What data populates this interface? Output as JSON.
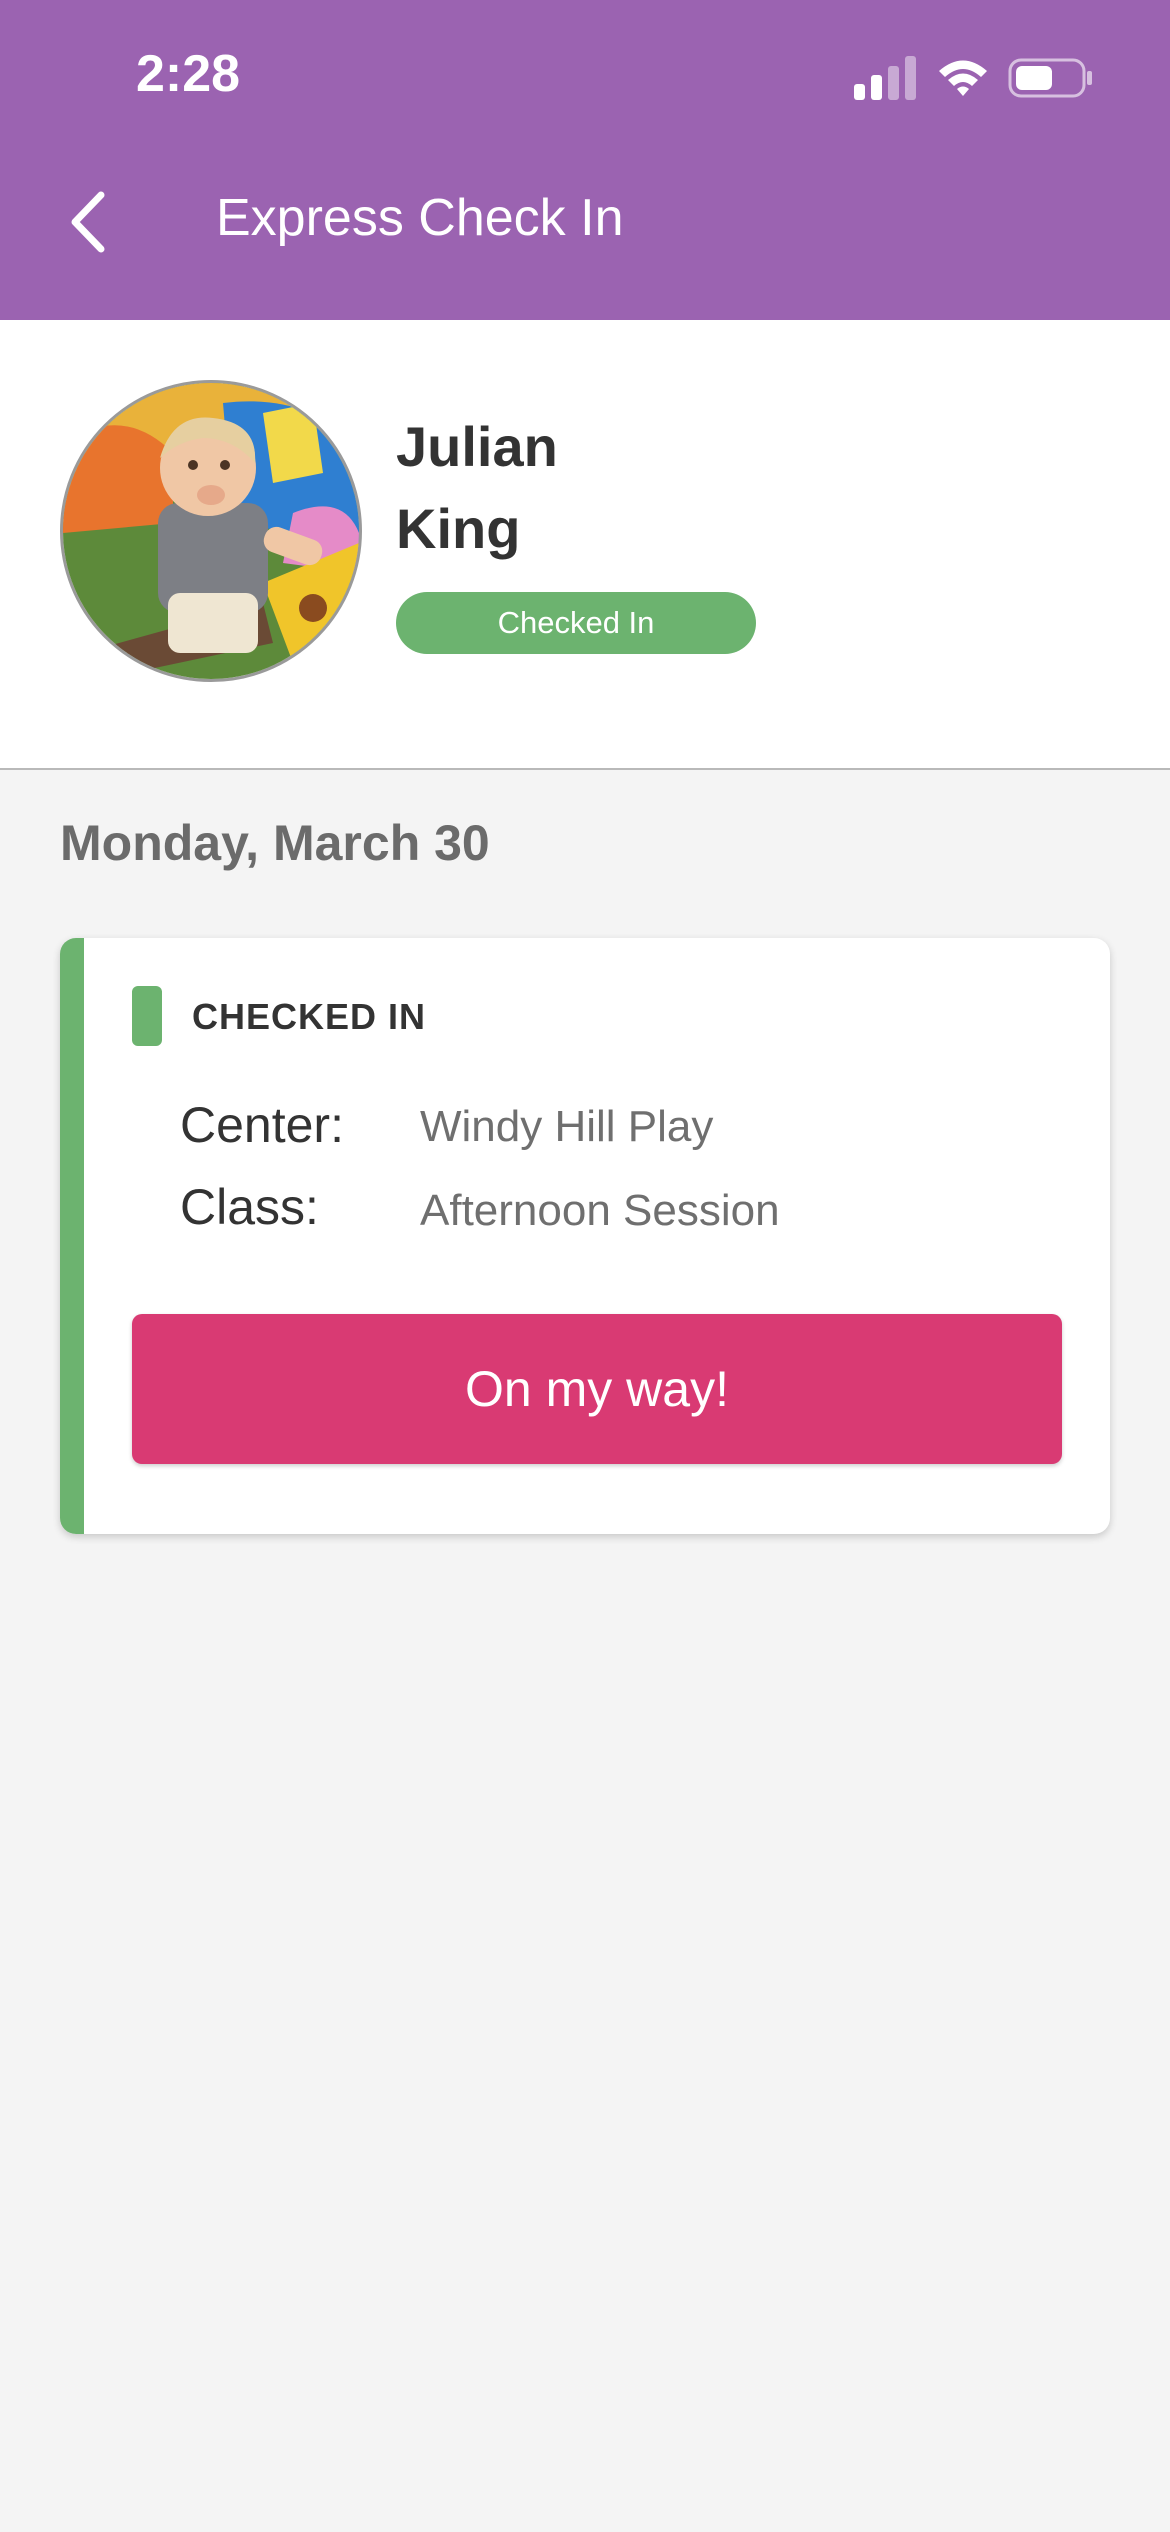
{
  "status_bar": {
    "time": "2:28"
  },
  "nav": {
    "title": "Express Check In"
  },
  "child": {
    "first_name": "Julian",
    "last_name": "King",
    "status_badge": "Checked In"
  },
  "date_heading": "Monday, March 30",
  "card": {
    "status_label": "CHECKED IN",
    "center_label": "Center:",
    "center_value": "Windy Hill Play",
    "class_label": "Class:",
    "class_value": "Afternoon Session",
    "action_label": "On my way!"
  },
  "colors": {
    "header": "#9b63b1",
    "status_green": "#6cb36f",
    "action_pink": "#d93a73",
    "background": "#f4f4f4"
  },
  "icons": {
    "back": "chevron-left-icon",
    "signal": "cellular-signal-icon",
    "wifi": "wifi-icon",
    "battery": "battery-icon"
  }
}
